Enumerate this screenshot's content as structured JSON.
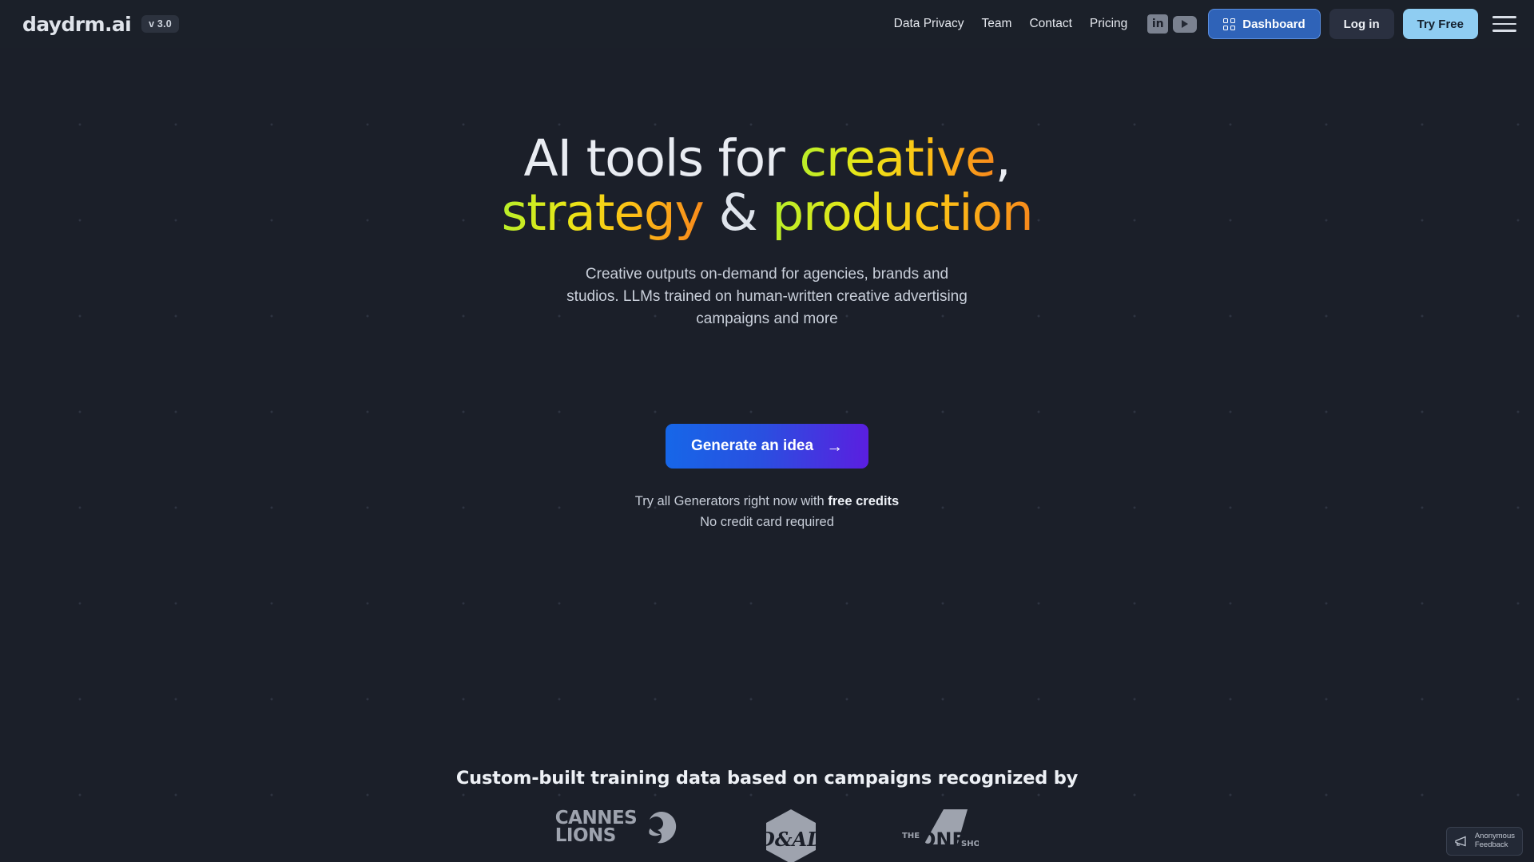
{
  "header": {
    "logo_text": "daydrm.ai",
    "version_badge": "v 3.0",
    "nav_links": [
      {
        "label": "Data Privacy",
        "name": "nav-data-privacy"
      },
      {
        "label": "Team",
        "name": "nav-team"
      },
      {
        "label": "Contact",
        "name": "nav-contact"
      },
      {
        "label": "Pricing",
        "name": "nav-pricing"
      }
    ],
    "social": {
      "linkedin_label": "in",
      "youtube_label": "youtube-play-icon"
    },
    "dashboard_button": "Dashboard",
    "login_button": "Log in",
    "try_free_button": "Try Free",
    "menu_icon": "hamburger-menu-icon"
  },
  "hero": {
    "headline_line1_plain": "AI tools for ",
    "headline_line1_grad": "creative",
    "headline_line1_comma": ",",
    "headline_line2_grad1": "strategy",
    "headline_line2_amp": " & ",
    "headline_line2_grad2": "production",
    "subtitle": "Creative outputs on-demand for agencies, brands and studios. LLMs trained on human-written creative advertising campaigns and more",
    "cta_label": "Generate an idea",
    "cta_arrow": "→",
    "credits_prefix": "Try all Generators right now with ",
    "credits_bold": "free credits",
    "credits_line2": "No credit card required"
  },
  "awards": {
    "heading": "Custom-built training data based on campaigns recognized by",
    "items": [
      {
        "name": "cannes-lions-logo",
        "line1": "CANNES",
        "line2": "LIONS"
      },
      {
        "name": "dandad-logo",
        "line1": "D&AD"
      },
      {
        "name": "one-show-logo",
        "the": "THE",
        "one": "ONE",
        "show": "SHOW"
      }
    ]
  },
  "feedback_widget": {
    "line1": "Anonymous",
    "line2": "Feedback",
    "icon": "megaphone-icon"
  },
  "colors": {
    "background": "#1b1f29",
    "header_background": "#1b2029",
    "accent_blue": "#2f63b8",
    "try_free_blue": "#8fcdf2",
    "gradient_start": "#b4ef2b",
    "gradient_mid": "#fcc216",
    "gradient_end": "#f8861c",
    "cta_gradient_start": "#1667e8",
    "cta_gradient_end": "#5b1ee0"
  }
}
